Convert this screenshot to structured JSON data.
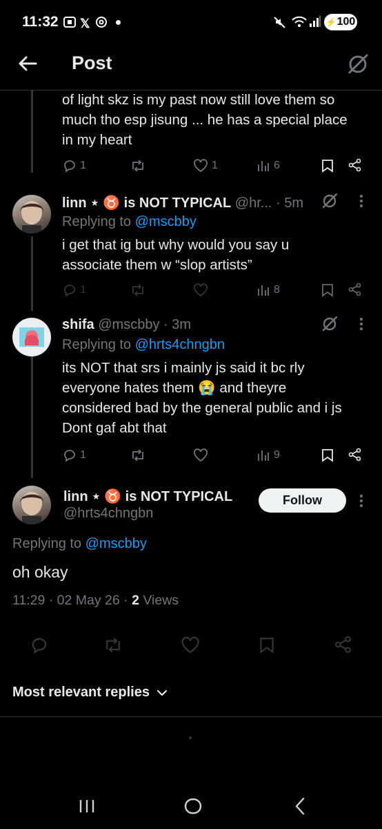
{
  "status_bar": {
    "time": "11:32",
    "battery": "100"
  },
  "header": {
    "title": "Post"
  },
  "tweets": [
    {
      "text_lines": [
        "of light skz is my past now still love them so",
        "much tho esp jisung ... he has a special place",
        "in my heart"
      ],
      "replies": "1",
      "likes": "1",
      "views": "6"
    },
    {
      "name": "linn ⋆ ♉ is NOT TYPICAL",
      "handle": "@hr...",
      "time": "5m",
      "replying_label": "Replying to",
      "replying_to": "@mscbby",
      "text_lines": [
        "i get that ig but why would you say u",
        "associate them w “slop artists”"
      ],
      "replies": "1",
      "views": "8"
    },
    {
      "name": "shifa",
      "handle": "@mscbby",
      "time": "3m",
      "replying_label": "Replying to",
      "replying_to": "@hrts4chngbn",
      "text_lines": [
        "its NOT that srs i mainly js said it bc rly",
        "everyone hates them 😭 and theyre",
        "considered bad by the general public and i js",
        "Dont gaf abt that"
      ],
      "replies": "1",
      "views": "9"
    }
  ],
  "main_post": {
    "name": "linn ⋆ ♉ is NOT TYPICAL",
    "handle": "@hrts4chngbn",
    "follow_label": "Follow",
    "replying_label": "Replying to",
    "replying_to": "@mscbby",
    "text": "oh okay",
    "time_date": "11:29 · 02 May 26 ·",
    "views_count": "2",
    "views_label": "Views"
  },
  "sort": {
    "label": "Most relevant replies"
  },
  "colors": {
    "accent": "#1d9bf0",
    "muted": "#71767b",
    "text": "#e7e9ea",
    "background": "#000000"
  }
}
